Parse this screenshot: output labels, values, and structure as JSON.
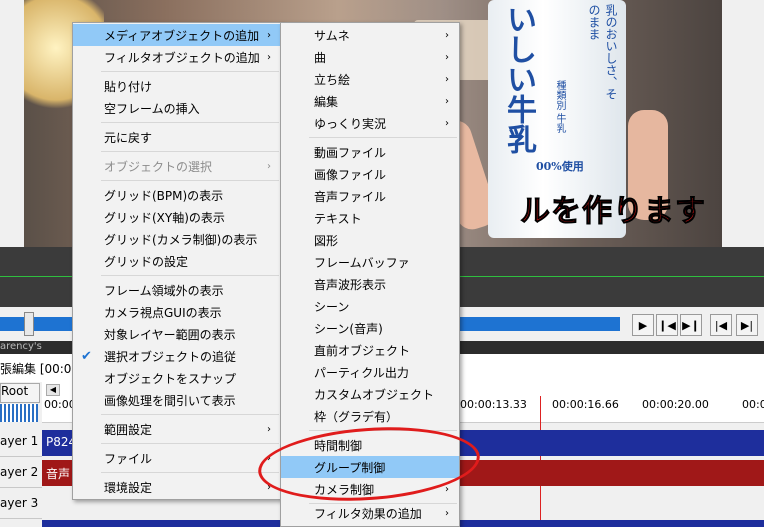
{
  "video": {
    "milk_text_top": "乳のおいしさ、そのまま",
    "milk_text_big": "いしい牛乳",
    "milk_small": "種類別 牛乳",
    "milk_percent": "00%使用",
    "caption": "ルを作ります"
  },
  "timeline": {
    "panel_title": "張編集 [00:00",
    "tab_hint": "arency's",
    "root_label": "Root",
    "time_labels": [
      "00:00",
      "00:00:13.33",
      "00:00:16.66",
      "00:00:20.00",
      "00:0"
    ],
    "layers": [
      "ayer 1",
      "ayer 2",
      "ayer 3"
    ],
    "clip1_label": "P824",
    "clip2_label": "音声"
  },
  "main_menu": {
    "items": [
      {
        "label": "メディアオブジェクトの追加",
        "arrow": "›"
      },
      {
        "label": "フィルタオブジェクトの追加",
        "arrow": "›"
      },
      {
        "label": "貼り付け"
      },
      {
        "label": "空フレームの挿入"
      },
      {
        "label": "元に戻す"
      },
      {
        "label": "オブジェクトの選択",
        "arrow": "›"
      },
      {
        "label": "グリッド(BPM)の表示"
      },
      {
        "label": "グリッド(XY軸)の表示"
      },
      {
        "label": "グリッド(カメラ制御)の表示"
      },
      {
        "label": "グリッドの設定"
      },
      {
        "label": "フレーム領域外の表示"
      },
      {
        "label": "カメラ視点GUIの表示"
      },
      {
        "label": "対象レイヤー範囲の表示"
      },
      {
        "label": "選択オブジェクトの追従",
        "check": "✔"
      },
      {
        "label": "オブジェクトをスナップ"
      },
      {
        "label": "画像処理を間引いて表示"
      },
      {
        "label": "範囲設定",
        "arrow": "›"
      },
      {
        "label": "ファイル",
        "arrow": "›"
      },
      {
        "label": "環境設定",
        "arrow": "›"
      }
    ]
  },
  "sub_menu": {
    "items": [
      {
        "label": "サムネ",
        "arrow": "›"
      },
      {
        "label": "曲",
        "arrow": "›"
      },
      {
        "label": "立ち絵",
        "arrow": "›"
      },
      {
        "label": "編集",
        "arrow": "›"
      },
      {
        "label": "ゆっくり実況",
        "arrow": "›"
      },
      {
        "label": "動画ファイル"
      },
      {
        "label": "画像ファイル"
      },
      {
        "label": "音声ファイル"
      },
      {
        "label": "テキスト"
      },
      {
        "label": "図形"
      },
      {
        "label": "フレームバッファ"
      },
      {
        "label": "音声波形表示"
      },
      {
        "label": "シーン"
      },
      {
        "label": "シーン(音声)"
      },
      {
        "label": "直前オブジェクト"
      },
      {
        "label": "パーティクル出力"
      },
      {
        "label": "カスタムオブジェクト"
      },
      {
        "label": "枠（グラデ有）"
      },
      {
        "label": "時間制御"
      },
      {
        "label": "グループ制御"
      },
      {
        "label": "カメラ制御",
        "arrow": "›"
      },
      {
        "label": "フィルタ効果の追加",
        "arrow": "›"
      }
    ]
  },
  "colors": {
    "highlight": "#91c9f7",
    "annotation_circle": "#e01c1c",
    "track_blue": "#1e2e9c",
    "track_red": "#a01818"
  }
}
